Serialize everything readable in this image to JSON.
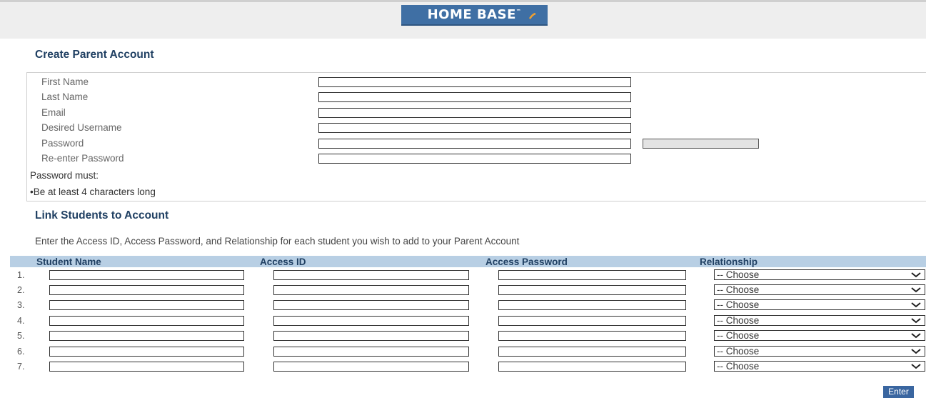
{
  "header": {
    "logo_text": "HOME BASE",
    "logo_tm": "™"
  },
  "account": {
    "title": "Create Parent Account",
    "fields": [
      {
        "label": "First Name",
        "value": ""
      },
      {
        "label": "Last Name",
        "value": ""
      },
      {
        "label": "Email",
        "value": ""
      },
      {
        "label": "Desired Username",
        "value": ""
      },
      {
        "label": "Password",
        "value": ""
      },
      {
        "label": "Re-enter Password",
        "value": ""
      }
    ],
    "password_rules_title": "Password must:",
    "password_rules": [
      "•Be at least 4 characters long"
    ]
  },
  "link": {
    "title": "Link Students to Account",
    "instructions": "Enter the Access ID, Access Password, and Relationship for each student you wish to add to your Parent Account",
    "columns": [
      "Student Name",
      "Access ID",
      "Access Password",
      "Relationship"
    ],
    "rows": [
      {
        "num": "1.",
        "relationship": "-- Choose"
      },
      {
        "num": "2.",
        "relationship": "-- Choose"
      },
      {
        "num": "3.",
        "relationship": "-- Choose"
      },
      {
        "num": "4.",
        "relationship": "-- Choose"
      },
      {
        "num": "5.",
        "relationship": "-- Choose"
      },
      {
        "num": "6.",
        "relationship": "-- Choose"
      },
      {
        "num": "7.",
        "relationship": "-- Choose"
      }
    ]
  },
  "actions": {
    "enter_label": "Enter"
  },
  "colors": {
    "brand": "#3f6fa4",
    "header_band": "#b8cfe4",
    "heading": "#1f3f62"
  }
}
